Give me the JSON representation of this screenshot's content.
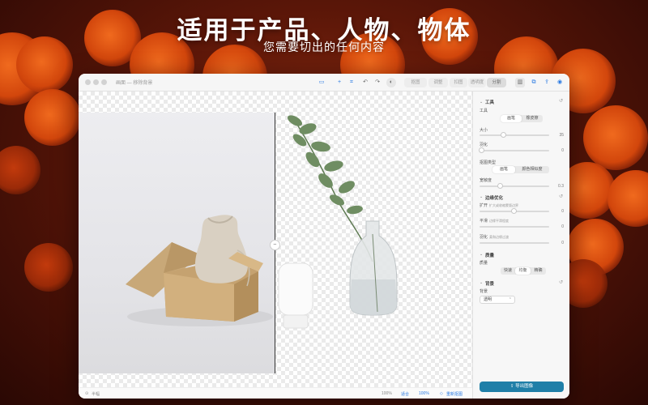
{
  "hero": {
    "title": "适用于产品、人物、物体",
    "subtitle": "您需要切出的任何内容"
  },
  "window": {
    "title": "画面 — 移除背景",
    "toolbar_tabs": [
      "抠图",
      "调整",
      "扣图",
      "透明度",
      "分割"
    ],
    "active_tab": "分割"
  },
  "statusbar": {
    "left": "半幅",
    "zoom_a": "100%",
    "fit": "适合",
    "zoom_b": "100%",
    "reset": "重新抠图"
  },
  "panel": {
    "tools_section": "工具",
    "tool_label": "工具",
    "tool_brush": "画笔",
    "tool_eraser": "橡皮擦",
    "size_label": "大小",
    "size_value": "35",
    "feather_label": "羽化",
    "feather_value": "0",
    "selection_type_label": "抠图类型",
    "sel_brush": "画笔",
    "sel_color": "颜色相似度",
    "tolerance_label": "宽敏度",
    "tolerance_value": "0.3",
    "edge_section": "边缘优化",
    "expand_label": "扩开",
    "expand_hint": "扩大或收缩蒙版边界",
    "expand_value": "0",
    "smooth_label": "平滑",
    "smooth_hint": "边缘平滑程度",
    "smooth_value": "0",
    "feather2_label": "羽化",
    "feather2_hint": "柔和边缘过渡",
    "feather2_value": "0",
    "quality_section": "质量",
    "quality_label": "质量",
    "q_fast": "快速",
    "q_balanced": "均衡",
    "q_fine": "精确",
    "bg_section": "背景",
    "bg_label": "背景",
    "bg_value": "透明",
    "export_button": "导出图像"
  }
}
